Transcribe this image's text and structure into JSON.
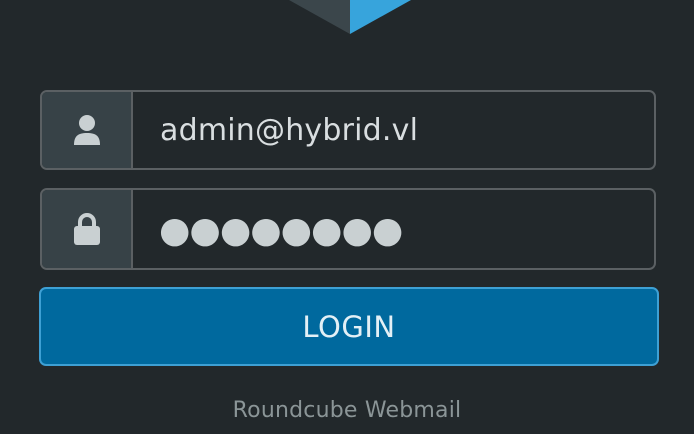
{
  "login_form": {
    "username": {
      "value": "admin@hybrid.vl",
      "icon": "user-icon"
    },
    "password": {
      "masked_value": "●●●●●●●●",
      "icon": "lock-icon"
    },
    "submit_label": "LOGIN"
  },
  "footer": {
    "product_name": "Roundcube Webmail"
  },
  "colors": {
    "background": "#22282b",
    "field_border": "#5b6063",
    "icon_cell": "#374247",
    "button": "#00699e",
    "button_border": "#3ea0d4",
    "text": "#d9dee0",
    "footer_text": "#8b9597"
  }
}
